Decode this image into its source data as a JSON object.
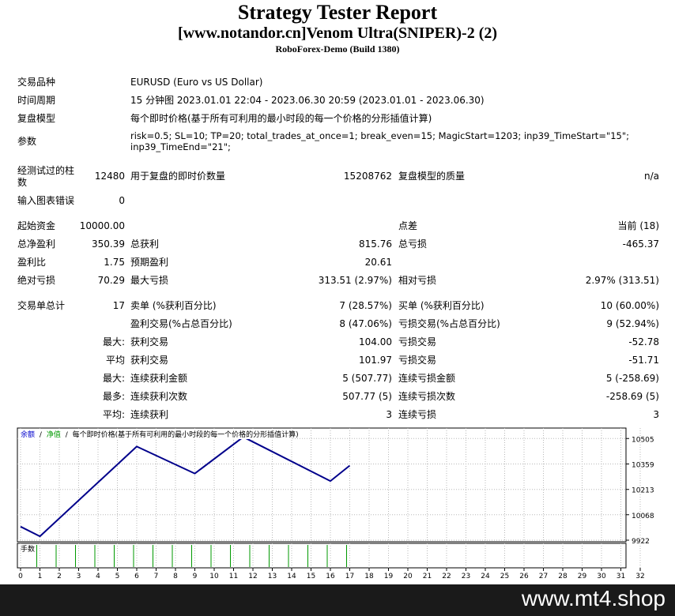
{
  "header": {
    "title": "Strategy Tester Report",
    "subtitle": "[www.notandor.cn]Venom Ultra(SNIPER)-2 (2)",
    "build": "RoboForex-Demo (Build 1380)"
  },
  "info": {
    "symbol_label": "交易品种",
    "symbol_value": "EURUSD (Euro vs US Dollar)",
    "period_label": "时间周期",
    "period_value": "15 分钟图 2023.01.01 22:04 - 2023.06.30 20:59 (2023.01.01 - 2023.06.30)",
    "model_label": "复盘模型",
    "model_value": "每个即时价格(基于所有可利用的最小时段的每一个价格的分形插值计算)",
    "params_label": "参数",
    "params_line1": "risk=0.5; SL=10; TP=20; total_trades_at_once=1; break_even=15; MagicStart=1203; inp39_TimeStart=\"15\";",
    "params_line2": "inp39_TimeEnd=\"21\";"
  },
  "bars": {
    "label_line1": "经测试过的柱",
    "label_line2": "数",
    "value": "12480",
    "ticks_label": "用于复盘的即时价数量",
    "ticks_value": "15208762",
    "quality_label": "复盘模型的质量",
    "quality_value": "n/a",
    "errors_label": "输入图表错误",
    "errors_value": "0"
  },
  "stats": {
    "deposit_label": "起始资金",
    "deposit_value": "10000.00",
    "spread_label": "点差",
    "spread_value": "当前 (18)",
    "net_label": "总净盈利",
    "net_value": "350.39",
    "gross_profit_label": "总获利",
    "gross_profit_value": "815.76",
    "gross_loss_label": "总亏损",
    "gross_loss_value": "-465.37",
    "pf_label": "盈利比",
    "pf_value": "1.75",
    "payoff_label": "预期盈利",
    "payoff_value": "20.61",
    "abs_dd_label": "绝对亏损",
    "abs_dd_value": "70.29",
    "max_dd_label": "最大亏损",
    "max_dd_value": "313.51 (2.97%)",
    "rel_dd_label": "相对亏损",
    "rel_dd_value": "2.97% (313.51)"
  },
  "trades": {
    "total_label": "交易单总计",
    "total_value": "17",
    "short_label": "卖单 (%获利百分比)",
    "short_value": "7 (28.57%)",
    "long_label": "买单 (%获利百分比)",
    "long_value": "10 (60.00%)",
    "profit_trades_label": "盈利交易(%占总百分比)",
    "profit_trades_value": "8 (47.06%)",
    "loss_trades_label": "亏损交易(%占总百分比)",
    "loss_trades_value": "9 (52.94%)",
    "largest_prefix": "最大:",
    "largest_profit_label": "获利交易",
    "largest_profit_value": "104.00",
    "largest_loss_label": "亏损交易",
    "largest_loss_value": "-52.78",
    "average_prefix": "平均",
    "avg_profit_label": "获利交易",
    "avg_profit_value": "101.97",
    "avg_loss_label": "亏损交易",
    "avg_loss_value": "-51.71",
    "max_prefix": "最大:",
    "max_cons_wins_label": "连续获利金额",
    "max_cons_wins_value": "5 (507.77)",
    "max_cons_losses_label": "连续亏损金额",
    "max_cons_losses_value": "5 (-258.69)",
    "maximal_prefix": "最多:",
    "maximal_cons_profit_label": "连续获利次数",
    "maximal_cons_profit_value": "507.77 (5)",
    "maximal_cons_loss_label": "连续亏损次数",
    "maximal_cons_loss_value": "-258.69 (5)",
    "avg_cons_prefix": "平均:",
    "avg_cons_wins_label": "连续获利",
    "avg_cons_wins_value": "3",
    "avg_cons_losses_label": "连续亏损",
    "avg_cons_losses_value": "3"
  },
  "chart_data": {
    "type": "line",
    "legend": {
      "balance": "余额",
      "sep1": "/",
      "equity": "净值",
      "sep2": "/",
      "model": "每个即时价格(基于所有可利用的最小时段的每一个价格的分形插值计算)"
    },
    "lots_label": "手数",
    "x": [
      0,
      1,
      6,
      9,
      11.5,
      16,
      17
    ],
    "y": [
      10000,
      9944,
      10459,
      10304,
      10514,
      10261,
      10350
    ],
    "xlim": [
      0,
      32
    ],
    "ylim": [
      9922,
      10565
    ],
    "x_ticks": [
      "0",
      "1",
      "2",
      "3",
      "4",
      "5",
      "6",
      "7",
      "8",
      "9",
      "10",
      "11",
      "12",
      "13",
      "14",
      "15",
      "16",
      "17",
      "18",
      "19",
      "20",
      "21",
      "22",
      "23",
      "24",
      "25",
      "26",
      "27",
      "28",
      "29",
      "30",
      "31",
      "32"
    ],
    "y_ticks": [
      "10505",
      "10359",
      "10213",
      "10068",
      "9922"
    ],
    "y_tick_values": [
      10505,
      10359,
      10213,
      10068,
      9922
    ],
    "lots": [
      1,
      2,
      3,
      4,
      5,
      6,
      7,
      8,
      9,
      10,
      11,
      12,
      13,
      14,
      15,
      16,
      17
    ],
    "colors": {
      "balance": "#00008b",
      "grid": "#b8b8b8",
      "lots": "#009900",
      "legend_balance": "#0000cc",
      "legend_equity": "#009900"
    }
  },
  "footer": {
    "text": "www.mt4.shop",
    "bg": "#1a1a1a"
  }
}
